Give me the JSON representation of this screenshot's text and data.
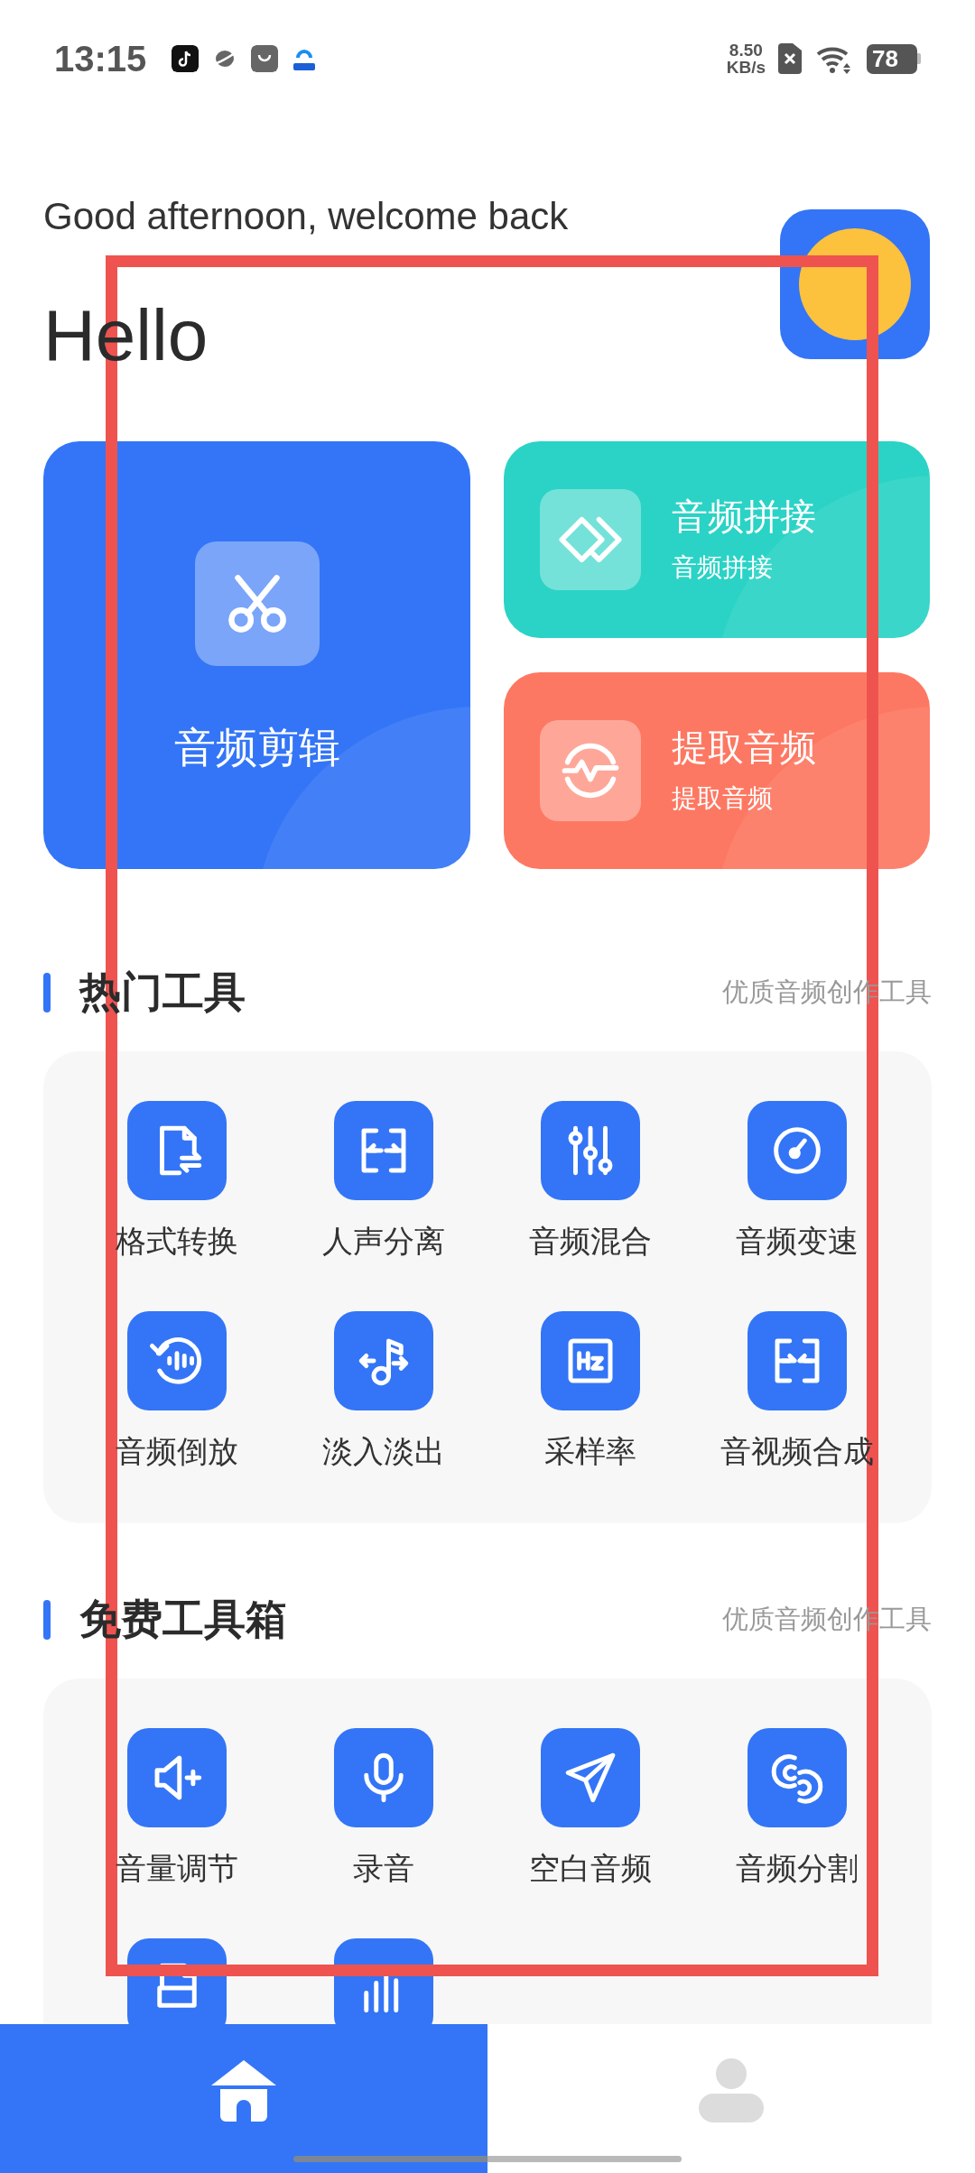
{
  "status_bar": {
    "time": "13:15",
    "net_speed": "8.50",
    "net_unit": "KB/s",
    "battery": "78"
  },
  "header": {
    "greeting": "Good afternoon, welcome back",
    "title": "Hello"
  },
  "feature_cards": [
    {
      "kind": "large",
      "title": "音频剪辑",
      "color": "#3375f6"
    },
    {
      "kind": "small",
      "title": "音频拼接",
      "subtitle": "音频拼接",
      "color": "#2ad3c5"
    },
    {
      "kind": "small",
      "title": "提取音频",
      "subtitle": "提取音频",
      "color": "#fd7862"
    }
  ],
  "sections": [
    {
      "title": "热门工具",
      "subtitle": "优质音频创作工具",
      "tools": [
        {
          "kind": "tool",
          "label": "格式转换"
        },
        {
          "kind": "tool",
          "label": "人声分离"
        },
        {
          "kind": "tool",
          "label": "音频混合"
        },
        {
          "kind": "tool",
          "label": "音频变速"
        },
        {
          "kind": "tool",
          "label": "音频倒放"
        },
        {
          "kind": "tool",
          "label": "淡入淡出"
        },
        {
          "kind": "tool",
          "label": "采样率"
        },
        {
          "kind": "tool",
          "label": "音视频合成"
        }
      ]
    },
    {
      "title": "免费工具箱",
      "subtitle": "优质音频创作工具",
      "tools": [
        {
          "kind": "tool",
          "label": "音量调节"
        },
        {
          "kind": "tool",
          "label": "录音"
        },
        {
          "kind": "tool",
          "label": "空白音频"
        },
        {
          "kind": "tool",
          "label": "音频分割"
        },
        {
          "kind": "partial"
        },
        {
          "kind": "partial"
        }
      ]
    }
  ],
  "tab_bar": [
    {
      "selected": true
    },
    {
      "selected": false
    }
  ]
}
